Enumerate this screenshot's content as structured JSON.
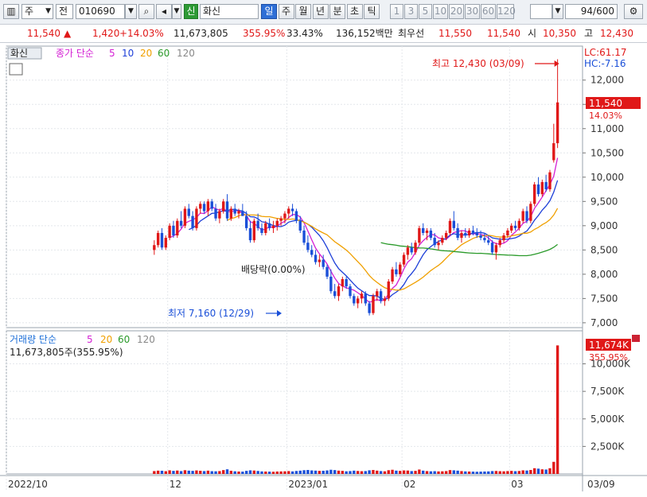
{
  "toolbar": {
    "market": "주",
    "type_label": "전",
    "code": "010690",
    "new_badge": "신",
    "name": "화신",
    "periods": [
      "일",
      "주",
      "월",
      "년",
      "분",
      "초",
      "틱"
    ],
    "active_period": "일",
    "intervals": [
      "1",
      "3",
      "5",
      "10",
      "20",
      "30",
      "60",
      "120"
    ],
    "page_count": "94",
    "page_total": "/600"
  },
  "quote": {
    "price": "11,540",
    "arrow": "▲",
    "change": "1,420",
    "change_pct": "+14.03%",
    "volume": "11,673,805",
    "volume_ratio": "355.95%",
    "turnover": "33.43%",
    "amount": "136,152백만",
    "bid_label": "최우선",
    "bid1": "11,550",
    "bid2": "11,540",
    "open_label": "시",
    "open": "10,350",
    "high_label": "고",
    "high": "12,430"
  },
  "price_panel": {
    "tag": "화신",
    "ma_label": "종가 단순",
    "ma_periods": [
      "5",
      "10",
      "20",
      "60",
      "120"
    ],
    "ma_colors": [
      "#d41fd4",
      "#1d3fd8",
      "#f0a000",
      "#2a9a2a",
      "#888888"
    ],
    "lc": "LC:61.17",
    "hc": "HC:-7.16",
    "current_price": "11,540",
    "current_pct": "14.03%",
    "high_note": "최고 12,430 (03/09)",
    "low_note": "최저 7,160 (12/29)",
    "ex_dividend": "배당락(0.00%)"
  },
  "volume_panel": {
    "ma_label": "거래량 단순",
    "ma_periods": [
      "5",
      "20",
      "60",
      "120"
    ],
    "summary": "11,673,805주(355.95%)",
    "current_volume": "11,674K",
    "current_pct": "355.95%"
  },
  "chart_data": {
    "type": "candlestick",
    "price_axis": {
      "range": [
        6900,
        12700
      ],
      "ticks": [
        7000,
        7500,
        8000,
        8500,
        9000,
        9500,
        10000,
        10500,
        11000,
        11500,
        12000
      ],
      "tick_labels": [
        "7,000",
        "7,500",
        "8,000",
        "8,500",
        "9,000",
        "9,500",
        "10,000",
        "10,500",
        "11,000",
        "11,500",
        "12,000"
      ]
    },
    "volume_axis": {
      "range": [
        0,
        13000
      ],
      "ticks": [
        2500,
        5000,
        7500,
        10000
      ],
      "tick_labels": [
        "2,500K",
        "5,000K",
        "7,500K",
        "10,000K"
      ]
    },
    "x_labels": [
      {
        "index": 0,
        "label": "2022/10"
      },
      {
        "index": 42,
        "label": "12"
      },
      {
        "index": 73,
        "label": "2023/01"
      },
      {
        "index": 103,
        "label": "02"
      },
      {
        "index": 131,
        "label": "03"
      },
      {
        "index": 149,
        "label": "03/09"
      }
    ],
    "total_slots": 150,
    "candles": [
      [
        8500,
        8700,
        8400,
        8600,
        260
      ],
      [
        8600,
        8900,
        8550,
        8850,
        300
      ],
      [
        8850,
        8950,
        8500,
        8550,
        290
      ],
      [
        8550,
        8800,
        8500,
        8750,
        250
      ],
      [
        8750,
        9050,
        8700,
        9000,
        330
      ],
      [
        9000,
        9100,
        8750,
        8800,
        280
      ],
      [
        8800,
        9150,
        8750,
        9100,
        310
      ],
      [
        9100,
        9300,
        8950,
        9000,
        260
      ],
      [
        9000,
        9400,
        8950,
        9350,
        340
      ],
      [
        9350,
        9450,
        9150,
        9200,
        300
      ],
      [
        9200,
        9300,
        8900,
        8950,
        280
      ],
      [
        8950,
        9400,
        8900,
        9350,
        320
      ],
      [
        9350,
        9500,
        9250,
        9450,
        290
      ],
      [
        9450,
        9500,
        9250,
        9300,
        260
      ],
      [
        9300,
        9550,
        9200,
        9500,
        300
      ],
      [
        9500,
        9550,
        9300,
        9350,
        250
      ],
      [
        9350,
        9450,
        9100,
        9150,
        240
      ],
      [
        9150,
        9350,
        9050,
        9300,
        260
      ],
      [
        9300,
        9550,
        9250,
        9500,
        350
      ],
      [
        9500,
        9650,
        9100,
        9150,
        420
      ],
      [
        9150,
        9400,
        9100,
        9350,
        290
      ],
      [
        9350,
        9450,
        9200,
        9250,
        240
      ],
      [
        9250,
        9350,
        9150,
        9300,
        220
      ],
      [
        9300,
        9450,
        9200,
        9200,
        210
      ],
      [
        9200,
        9300,
        8900,
        8950,
        280
      ],
      [
        8950,
        9100,
        8650,
        8700,
        330
      ],
      [
        8700,
        9150,
        8650,
        9100,
        310
      ],
      [
        9100,
        9250,
        8900,
        8950,
        270
      ],
      [
        8950,
        9050,
        8800,
        8850,
        230
      ],
      [
        8850,
        9100,
        8800,
        9050,
        220
      ],
      [
        9050,
        9150,
        8900,
        8950,
        210
      ],
      [
        8950,
        9100,
        8850,
        9000,
        200
      ],
      [
        9000,
        9150,
        8900,
        9100,
        220
      ],
      [
        9100,
        9200,
        9000,
        9150,
        230
      ],
      [
        9150,
        9300,
        9050,
        9250,
        240
      ],
      [
        9250,
        9400,
        9150,
        9350,
        260
      ],
      [
        9350,
        9450,
        9200,
        9300,
        230
      ],
      [
        9300,
        9350,
        9050,
        9100,
        270
      ],
      [
        9100,
        9200,
        8850,
        8900,
        300
      ],
      [
        8900,
        9000,
        8600,
        8650,
        340
      ],
      [
        8650,
        8800,
        8450,
        8500,
        360
      ],
      [
        8500,
        8600,
        8350,
        8400,
        320
      ],
      [
        8400,
        8500,
        8200,
        8250,
        300
      ],
      [
        8250,
        8400,
        8150,
        8300,
        280
      ],
      [
        8300,
        8400,
        8100,
        8150,
        290
      ],
      [
        8150,
        8200,
        7900,
        7950,
        320
      ],
      [
        7950,
        8100,
        7600,
        7650,
        380
      ],
      [
        7650,
        7800,
        7500,
        7550,
        350
      ],
      [
        7550,
        7800,
        7450,
        7750,
        300
      ],
      [
        7750,
        7950,
        7650,
        7900,
        280
      ],
      [
        7900,
        7950,
        7700,
        7750,
        240
      ],
      [
        7750,
        7800,
        7500,
        7550,
        260
      ],
      [
        7550,
        7600,
        7350,
        7400,
        300
      ],
      [
        7400,
        7550,
        7300,
        7500,
        270
      ],
      [
        7500,
        7650,
        7400,
        7600,
        250
      ],
      [
        7600,
        7650,
        7350,
        7400,
        260
      ],
      [
        7400,
        7450,
        7150,
        7200,
        330
      ],
      [
        7200,
        7600,
        7160,
        7550,
        360
      ],
      [
        7550,
        7700,
        7450,
        7650,
        300
      ],
      [
        7650,
        7700,
        7400,
        7450,
        260
      ],
      [
        7450,
        7550,
        7350,
        7500,
        240
      ],
      [
        7500,
        7900,
        7450,
        7850,
        340
      ],
      [
        7850,
        8150,
        7800,
        8100,
        380
      ],
      [
        8100,
        8250,
        7950,
        8000,
        300
      ],
      [
        8000,
        8250,
        7950,
        8200,
        280
      ],
      [
        8200,
        8450,
        8150,
        8400,
        320
      ],
      [
        8400,
        8600,
        8300,
        8550,
        310
      ],
      [
        8550,
        8650,
        8400,
        8450,
        260
      ],
      [
        8450,
        8700,
        8400,
        8650,
        280
      ],
      [
        8650,
        9000,
        8600,
        8950,
        400
      ],
      [
        8950,
        9050,
        8800,
        8850,
        300
      ],
      [
        8850,
        8950,
        8700,
        8900,
        260
      ],
      [
        8900,
        8950,
        8700,
        8750,
        240
      ],
      [
        8750,
        8850,
        8550,
        8600,
        250
      ],
      [
        8600,
        8700,
        8500,
        8650,
        230
      ],
      [
        8650,
        8800,
        8600,
        8750,
        240
      ],
      [
        8750,
        8900,
        8700,
        8850,
        260
      ],
      [
        8850,
        9150,
        8800,
        9100,
        350
      ],
      [
        9100,
        9300,
        8900,
        8950,
        330
      ],
      [
        8950,
        9050,
        8700,
        8750,
        300
      ],
      [
        8750,
        8900,
        8650,
        8850,
        260
      ],
      [
        8850,
        8950,
        8750,
        8800,
        230
      ],
      [
        8800,
        8950,
        8750,
        8900,
        220
      ],
      [
        8900,
        9000,
        8800,
        8850,
        210
      ],
      [
        8850,
        8950,
        8750,
        8800,
        200
      ],
      [
        8800,
        8900,
        8700,
        8750,
        210
      ],
      [
        8750,
        8850,
        8650,
        8700,
        220
      ],
      [
        8700,
        8800,
        8600,
        8650,
        230
      ],
      [
        8650,
        8700,
        8400,
        8450,
        260
      ],
      [
        8450,
        8650,
        8300,
        8600,
        270
      ],
      [
        8600,
        8750,
        8550,
        8700,
        250
      ],
      [
        8700,
        8850,
        8650,
        8800,
        240
      ],
      [
        8800,
        8950,
        8750,
        8900,
        260
      ],
      [
        8900,
        9050,
        8850,
        9000,
        280
      ],
      [
        9000,
        9100,
        8900,
        8950,
        250
      ],
      [
        8950,
        9150,
        8900,
        9100,
        270
      ],
      [
        9100,
        9350,
        9050,
        9300,
        330
      ],
      [
        9300,
        9400,
        9050,
        9100,
        310
      ],
      [
        9100,
        9500,
        9050,
        9450,
        360
      ],
      [
        9450,
        9900,
        9400,
        9850,
        520
      ],
      [
        9850,
        10000,
        9600,
        9650,
        480
      ],
      [
        9650,
        9950,
        9600,
        9900,
        420
      ],
      [
        9900,
        10050,
        9700,
        9750,
        400
      ],
      [
        9750,
        10150,
        9700,
        10100,
        520
      ],
      [
        10350,
        11100,
        10300,
        10700,
        1100
      ],
      [
        10700,
        12430,
        10600,
        11540,
        11674
      ]
    ],
    "ma_lines_note": "Moving averages (5,10,20,60,120) computed from close values"
  }
}
